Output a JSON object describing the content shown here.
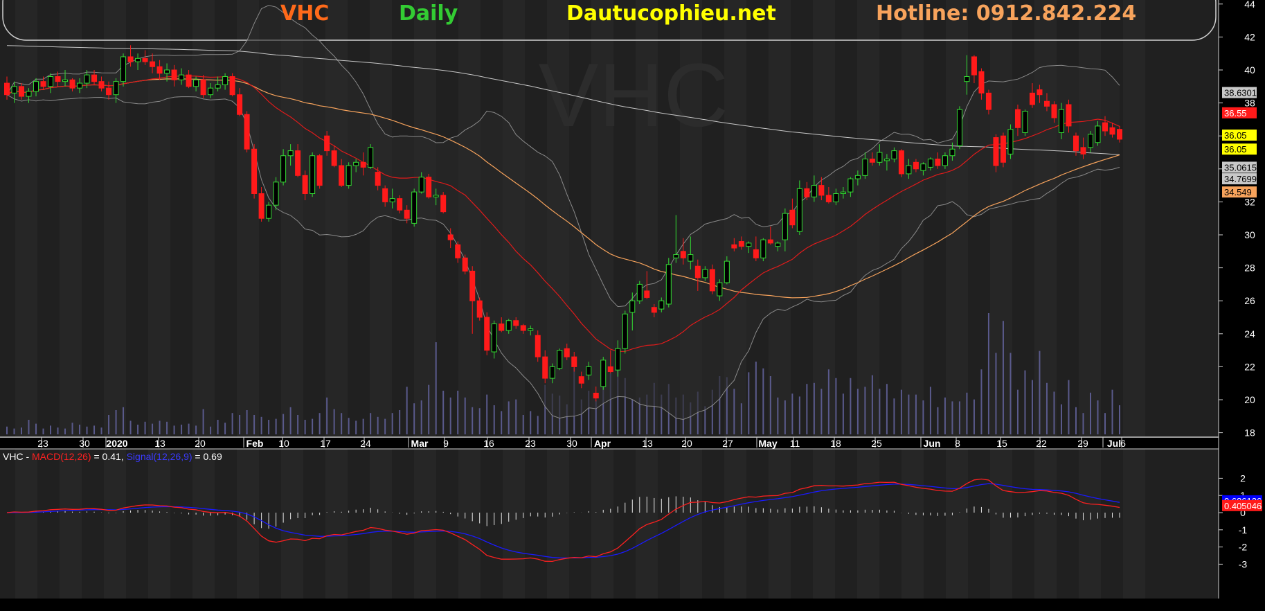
{
  "header": {
    "symbol": "VHC",
    "period": "Daily",
    "site": "Dautucophieu.net",
    "hotline": "Hotline: 0912.842.224",
    "colors": {
      "symbol": "#ff6a1a",
      "period": "#33cc33",
      "site": "#ffff00",
      "hotline": "#f7a35c"
    }
  },
  "watermark": "VHC",
  "price_axis": {
    "ticks": [
      "44",
      "42",
      "40",
      "38",
      "36",
      "34",
      "32",
      "30",
      "28",
      "26",
      "24",
      "22",
      "20",
      "18"
    ],
    "labels": [
      {
        "text": "38.6301",
        "value": 38.63,
        "bg": "#c8c8c8",
        "fg": "#000000"
      },
      {
        "text": "36.55",
        "value": 37.4,
        "bg": "#ff1a1a",
        "fg": "#ffffff"
      },
      {
        "text": "36.05",
        "value": 36.05,
        "bg": "#ffff00",
        "fg": "#000000"
      },
      {
        "text": "36.05",
        "value": 35.2,
        "bg": "#ffff00",
        "fg": "#000000"
      },
      {
        "text": "35.0615",
        "value": 34.1,
        "bg": "#c8c8c8",
        "fg": "#000000"
      },
      {
        "text": "34.7699",
        "value": 33.4,
        "bg": "#c8c8c8",
        "fg": "#000000"
      },
      {
        "text": "34.549",
        "value": 32.6,
        "bg": "#f7a35c",
        "fg": "#000000"
      }
    ]
  },
  "date_axis": [
    "23",
    "30",
    "2020",
    "13",
    "20",
    "Feb",
    "10",
    "17",
    "24",
    "Mar",
    "9",
    "16",
    "23",
    "30",
    "Apr",
    "13",
    "20",
    "27",
    "May",
    "11",
    "18",
    "25",
    "Jun",
    "8",
    "15",
    "22",
    "29",
    "Jul",
    "6"
  ],
  "macd": {
    "legend": {
      "symbol": "VHC - ",
      "macd_name": "MACD(12,26)",
      "macd_value": " = 0.41, ",
      "signal_name": "Signal(12,26,9)",
      "signal_value": " = 0.69"
    },
    "axis_ticks": [
      "2",
      "1",
      "0",
      "-1",
      "-2",
      "-3"
    ],
    "labels": [
      {
        "text": "0.686126",
        "value": 0.69,
        "bg": "#0000ff",
        "fg": "#ffffff"
      },
      {
        "text": "0.405046",
        "value": 0.41,
        "bg": "#ff1a1a",
        "fg": "#ffffff"
      }
    ]
  },
  "chart_data": [
    {
      "type": "candlestick",
      "title": "VHC Daily",
      "ylim": [
        17,
        45
      ],
      "ohlc": [
        [
          39.2,
          39.6,
          38.2,
          38.5
        ],
        [
          38.6,
          39.3,
          38.0,
          39.0
        ],
        [
          39.0,
          39.2,
          38.2,
          38.4
        ],
        [
          38.4,
          38.9,
          38.0,
          38.7
        ],
        [
          38.7,
          39.5,
          38.4,
          39.3
        ],
        [
          39.3,
          39.6,
          38.8,
          39.0
        ],
        [
          39.0,
          39.8,
          38.6,
          39.6
        ],
        [
          39.6,
          39.9,
          39.0,
          39.3
        ],
        [
          39.3,
          40.0,
          39.0,
          39.4
        ],
        [
          39.4,
          39.5,
          38.7,
          38.9
        ],
        [
          38.9,
          39.5,
          38.6,
          39.2
        ],
        [
          39.2,
          40.0,
          38.9,
          39.7
        ],
        [
          39.7,
          40.0,
          39.1,
          39.3
        ],
        [
          39.3,
          39.6,
          38.7,
          38.9
        ],
        [
          38.9,
          39.3,
          38.2,
          38.5
        ],
        [
          38.5,
          39.5,
          38.0,
          39.3
        ],
        [
          39.3,
          41.0,
          39.0,
          40.8
        ],
        [
          40.8,
          41.5,
          40.2,
          40.5
        ],
        [
          40.5,
          41.0,
          40.0,
          40.7
        ],
        [
          40.7,
          41.2,
          40.3,
          40.5
        ],
        [
          40.5,
          41.0,
          39.8,
          40.2
        ],
        [
          40.2,
          40.6,
          39.4,
          39.8
        ],
        [
          39.8,
          40.4,
          39.3,
          40.0
        ],
        [
          40.0,
          40.3,
          39.0,
          39.4
        ],
        [
          39.4,
          40.1,
          39.1,
          39.7
        ],
        [
          39.7,
          40.0,
          38.9,
          39.0
        ],
        [
          39.0,
          39.6,
          38.7,
          39.4
        ],
        [
          39.4,
          39.7,
          38.3,
          38.5
        ],
        [
          38.5,
          39.2,
          38.3,
          38.9
        ],
        [
          38.9,
          39.6,
          38.7,
          39.1
        ],
        [
          39.1,
          39.8,
          38.8,
          39.6
        ],
        [
          39.6,
          39.8,
          38.4,
          38.5
        ],
        [
          38.5,
          38.9,
          37.2,
          37.3
        ],
        [
          37.3,
          37.5,
          35.0,
          35.2
        ],
        [
          35.2,
          35.5,
          32.2,
          32.5
        ],
        [
          32.5,
          32.9,
          30.8,
          31.0
        ],
        [
          31.0,
          32.0,
          30.8,
          31.8
        ],
        [
          31.8,
          33.5,
          31.5,
          33.2
        ],
        [
          33.2,
          35.2,
          33.0,
          34.8
        ],
        [
          34.8,
          35.5,
          34.2,
          35.1
        ],
        [
          35.1,
          35.5,
          33.5,
          33.6
        ],
        [
          33.6,
          33.9,
          32.1,
          32.5
        ],
        [
          32.5,
          35.0,
          32.3,
          34.8
        ],
        [
          34.8,
          34.9,
          32.8,
          33.0
        ],
        [
          36.0,
          36.3,
          34.8,
          35.1
        ],
        [
          35.1,
          35.4,
          34.1,
          34.2
        ],
        [
          34.2,
          34.6,
          32.9,
          33.0
        ],
        [
          33.0,
          34.4,
          32.8,
          34.2
        ],
        [
          34.2,
          34.6,
          33.8,
          34.4
        ],
        [
          34.4,
          35.0,
          33.6,
          34.1
        ],
        [
          34.1,
          35.5,
          34.0,
          35.3
        ],
        [
          33.8,
          34.1,
          32.7,
          33.0
        ],
        [
          32.8,
          33.0,
          31.7,
          32.0
        ],
        [
          32.0,
          32.8,
          31.6,
          32.2
        ],
        [
          32.2,
          32.4,
          31.3,
          31.5
        ],
        [
          31.5,
          31.8,
          30.7,
          31.0
        ],
        [
          30.7,
          32.8,
          30.5,
          32.6
        ],
        [
          32.6,
          33.8,
          32.5,
          33.5
        ],
        [
          33.5,
          33.7,
          32.2,
          32.3
        ],
        [
          32.3,
          32.8,
          31.8,
          32.4
        ],
        [
          32.4,
          32.6,
          31.3,
          31.4
        ],
        [
          30.0,
          30.4,
          29.2,
          29.7
        ],
        [
          29.4,
          29.6,
          28.3,
          28.6
        ],
        [
          28.6,
          28.8,
          27.6,
          27.8
        ],
        [
          27.8,
          28.1,
          24.0,
          26.0
        ],
        [
          26.0,
          26.2,
          24.8,
          25.0
        ],
        [
          25.0,
          25.3,
          22.7,
          23.0
        ],
        [
          22.9,
          24.8,
          22.5,
          24.6
        ],
        [
          24.6,
          25.0,
          24.1,
          24.2
        ],
        [
          24.2,
          24.9,
          24.0,
          24.8
        ],
        [
          24.8,
          25.0,
          24.3,
          24.5
        ],
        [
          24.5,
          24.6,
          24.0,
          24.2
        ],
        [
          24.2,
          24.5,
          23.9,
          24.3
        ],
        [
          23.9,
          24.2,
          22.3,
          22.6
        ],
        [
          22.6,
          23.0,
          21.0,
          21.3
        ],
        [
          21.3,
          22.2,
          21.0,
          22.0
        ],
        [
          21.9,
          23.1,
          21.8,
          23.0
        ],
        [
          23.1,
          23.4,
          22.4,
          22.6
        ],
        [
          22.6,
          22.9,
          21.7,
          22.0
        ],
        [
          21.4,
          21.7,
          20.7,
          21.0
        ],
        [
          21.5,
          22.3,
          21.2,
          22.0
        ],
        [
          20.4,
          20.8,
          19.9,
          20.1
        ],
        [
          20.8,
          22.6,
          20.6,
          22.4
        ],
        [
          22.0,
          23.0,
          21.6,
          21.7
        ],
        [
          21.8,
          23.6,
          21.4,
          23.1
        ],
        [
          23.1,
          25.4,
          22.8,
          25.2
        ],
        [
          25.3,
          26.5,
          24.2,
          26.0
        ],
        [
          26.0,
          27.2,
          25.8,
          27.0
        ],
        [
          26.6,
          27.8,
          26.1,
          26.2
        ],
        [
          25.6,
          25.8,
          25.0,
          25.3
        ],
        [
          25.5,
          26.2,
          25.3,
          26.0
        ],
        [
          25.8,
          28.6,
          25.6,
          28.2
        ],
        [
          28.6,
          31.2,
          28.3,
          28.8
        ],
        [
          29.0,
          29.8,
          28.2,
          28.6
        ],
        [
          28.4,
          29.9,
          27.9,
          28.8
        ],
        [
          28.1,
          28.5,
          26.6,
          27.4
        ],
        [
          27.4,
          28.1,
          27.2,
          27.9
        ],
        [
          27.9,
          28.2,
          26.4,
          26.6
        ],
        [
          26.3,
          27.3,
          26.0,
          27.1
        ],
        [
          27.1,
          28.7,
          27.0,
          28.4
        ],
        [
          29.4,
          29.8,
          29.0,
          29.2
        ],
        [
          29.6,
          29.9,
          29.1,
          29.3
        ],
        [
          29.3,
          29.6,
          28.9,
          29.5
        ],
        [
          29.1,
          29.9,
          28.4,
          28.6
        ],
        [
          28.6,
          29.8,
          28.4,
          29.7
        ],
        [
          29.7,
          30.5,
          29.4,
          29.5
        ],
        [
          29.3,
          29.6,
          29.0,
          29.5
        ],
        [
          29.7,
          31.6,
          29.0,
          31.3
        ],
        [
          31.5,
          32.2,
          30.4,
          30.6
        ],
        [
          30.2,
          33.3,
          30.0,
          32.8
        ],
        [
          32.8,
          33.2,
          32.1,
          32.3
        ],
        [
          32.3,
          33.6,
          32.0,
          33.0
        ],
        [
          33.0,
          33.5,
          32.1,
          32.4
        ],
        [
          32.4,
          32.9,
          31.9,
          32.0
        ],
        [
          32.0,
          32.8,
          31.8,
          32.5
        ],
        [
          32.5,
          32.9,
          32.2,
          32.6
        ],
        [
          32.6,
          33.5,
          32.3,
          33.4
        ],
        [
          33.4,
          33.9,
          33.0,
          33.6
        ],
        [
          33.6,
          35.0,
          33.4,
          34.6
        ],
        [
          34.6,
          35.0,
          34.2,
          34.4
        ],
        [
          34.4,
          35.5,
          34.2,
          35.0
        ],
        [
          34.5,
          34.9,
          33.9,
          34.6
        ],
        [
          34.6,
          35.3,
          34.4,
          35.1
        ],
        [
          35.1,
          35.2,
          33.5,
          33.7
        ],
        [
          33.7,
          34.6,
          33.4,
          34.2
        ],
        [
          34.4,
          34.6,
          33.8,
          34.0
        ],
        [
          33.9,
          34.4,
          33.6,
          34.3
        ],
        [
          34.1,
          34.7,
          33.9,
          34.6
        ],
        [
          34.6,
          35.0,
          34.0,
          34.2
        ],
        [
          34.2,
          35.0,
          34.0,
          34.8
        ],
        [
          34.8,
          35.6,
          34.5,
          35.2
        ],
        [
          35.4,
          37.8,
          35.2,
          37.6
        ],
        [
          39.3,
          40.9,
          38.5,
          39.6
        ],
        [
          40.8,
          40.9,
          39.2,
          39.7
        ],
        [
          39.9,
          40.1,
          38.2,
          38.6
        ],
        [
          38.6,
          38.8,
          37.3,
          37.6
        ],
        [
          35.9,
          36.1,
          33.8,
          34.2
        ],
        [
          36.0,
          36.2,
          34.1,
          34.4
        ],
        [
          34.9,
          36.7,
          34.6,
          36.4
        ],
        [
          37.6,
          37.9,
          36.0,
          36.5
        ],
        [
          36.2,
          37.6,
          36.0,
          37.5
        ],
        [
          38.6,
          39.2,
          37.7,
          37.9
        ],
        [
          38.8,
          39.1,
          38.0,
          38.5
        ],
        [
          38.1,
          38.6,
          37.5,
          37.8
        ],
        [
          37.9,
          38.1,
          36.8,
          37.1
        ],
        [
          36.2,
          38.0,
          35.8,
          37.6
        ],
        [
          37.9,
          38.2,
          36.2,
          36.6
        ],
        [
          36.0,
          36.2,
          34.8,
          35.1
        ],
        [
          35.3,
          35.9,
          34.6,
          34.9
        ],
        [
          35.3,
          36.3,
          35.0,
          36.1
        ],
        [
          35.6,
          36.9,
          35.4,
          36.6
        ],
        [
          36.8,
          37.2,
          36.0,
          36.3
        ],
        [
          36.5,
          36.8,
          35.9,
          36.1
        ],
        [
          36.4,
          36.6,
          35.6,
          35.8
        ]
      ],
      "volume": [
        0.8,
        0.6,
        0.7,
        1.5,
        1.1,
        0.6,
        0.9,
        0.7,
        0.6,
        1.2,
        1.0,
        0.8,
        0.9,
        0.7,
        2.0,
        2.5,
        2.8,
        1.4,
        1.0,
        1.3,
        1.1,
        1.4,
        1.3,
        0.9,
        1.0,
        1.1,
        0.9,
        2.6,
        0.8,
        1.5,
        1.2,
        2.2,
        2.0,
        2.5,
        2.0,
        1.8,
        1.5,
        1.6,
        2.1,
        2.8,
        2.0,
        1.5,
        1.6,
        2.2,
        3.8,
        2.6,
        2.2,
        1.7,
        1.4,
        1.6,
        2.2,
        1.8,
        1.6,
        2.2,
        2.5,
        4.9,
        3.2,
        3.5,
        5.1,
        9.5,
        4.5,
        3.8,
        4.5,
        3.8,
        2.8,
        2.7,
        4.1,
        3.0,
        2.4,
        3.4,
        3.6,
        2.0,
        2.4,
        1.9,
        5.1,
        4.2,
        4.0,
        3.1,
        6.9,
        3.6,
        4.5,
        3.5,
        5.0,
        6.3,
        7.0,
        5.8,
        3.6,
        3.8,
        4.1,
        5.3,
        4.1,
        5.2,
        3.8,
        4.1,
        3.3,
        4.4,
        2.9,
        4.6,
        6.0,
        5.9,
        4.7,
        3.2,
        6.4,
        7.5,
        6.8,
        6.0,
        3.8,
        3.5,
        4.2,
        3.9,
        5.2,
        5.3,
        4.7,
        6.7,
        5.8,
        4.2,
        5.8,
        4.7,
        4.9,
        6.1,
        4.7,
        5.2,
        3.7,
        4.6,
        4.1,
        4.1,
        3.5,
        4.9,
        2.8,
        3.8,
        3.4,
        3.4,
        4.3,
        3.6,
        6.7,
        12.5,
        8.4,
        11.7,
        8.4,
        4.6,
        6.6,
        5.6,
        8.6,
        5.3,
        4.4,
        3.1,
        5.6,
        2.8,
        2.2,
        4.3,
        3.5,
        2.2,
        4.6,
        3.0,
        2.3,
        1.8,
        1.5,
        1.6
      ],
      "series": [
        {
          "name": "MA20",
          "color": "#e01b1b"
        },
        {
          "name": "MA50",
          "color": "#f7a35c"
        },
        {
          "name": "MA200",
          "color": "#c8c8c8"
        },
        {
          "name": "Bollinger Bands",
          "color": "#8a8a8a"
        }
      ]
    },
    {
      "type": "line",
      "title": "MACD(12,26) / Signal(12,26,9)",
      "ylim": [
        -3.2,
        2.4
      ],
      "series": [
        {
          "name": "MACD(12,26)",
          "color": "#ff2020"
        },
        {
          "name": "Signal(12,26,9)",
          "color": "#1a1aff"
        },
        {
          "name": "Histogram",
          "color": "#e6e6e6"
        }
      ],
      "last_values": {
        "macd": 0.41,
        "signal": 0.69
      }
    }
  ]
}
